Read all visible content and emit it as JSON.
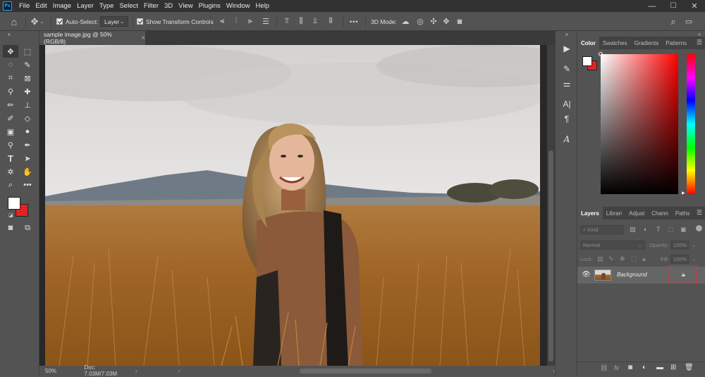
{
  "menubar": {
    "logo": "Ps",
    "items": [
      "File",
      "Edit",
      "Image",
      "Layer",
      "Type",
      "Select",
      "Filter",
      "3D",
      "View",
      "Plugins",
      "Window",
      "Help"
    ],
    "controls": {
      "minimize": "—",
      "maximize": "☐",
      "close": "✕"
    }
  },
  "options": {
    "auto_select_label": "Auto-Select:",
    "auto_select_target": "Layer",
    "show_transform_label": "Show Transform Controls",
    "more": "•••",
    "mode_3d_label": "3D Mode:"
  },
  "document": {
    "tab_title": "sample image.jpg @ 50% (RGB/8)",
    "close_glyph": "×",
    "zoom": "50%",
    "doc_info": "Doc: 7.03M/7.03M"
  },
  "color_panel": {
    "tabs": [
      "Color",
      "Swatches",
      "Gradients",
      "Patterns"
    ],
    "active_tab": "Color",
    "foreground": "#ffffff",
    "background": "#e52222"
  },
  "layers_panel": {
    "tabs": [
      "Layers",
      "Librari",
      "Adjust",
      "Chann",
      "Paths"
    ],
    "active_tab": "Layers",
    "kind_placeholder": "Kind",
    "blend_mode": "Normal",
    "opacity_label": "Opacity:",
    "opacity_value": "100%",
    "lock_label": "Lock:",
    "fill_label": "Fill:",
    "fill_value": "100%",
    "layers": [
      {
        "name": "Background",
        "visible": true,
        "locked": true
      }
    ]
  },
  "colors": {
    "highlight": "#e03030",
    "accent": "#31a8ff"
  }
}
